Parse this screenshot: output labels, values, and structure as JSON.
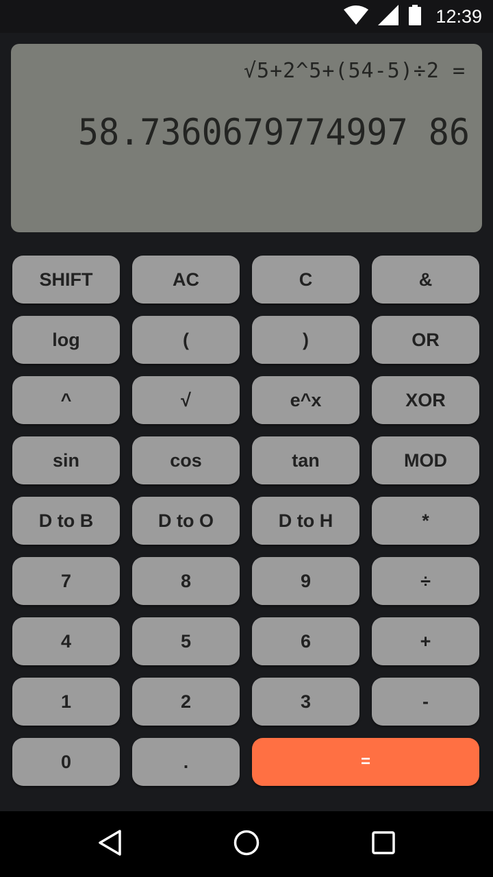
{
  "status_bar": {
    "time": "12:39",
    "icons": [
      "wifi-icon",
      "signal-icon",
      "battery-icon"
    ]
  },
  "display": {
    "expression": "√5+2^5+(54-5)÷2 =",
    "result": "58.7360679774997 86"
  },
  "keys": [
    {
      "label": "SHIFT",
      "name": "shift-button"
    },
    {
      "label": "AC",
      "name": "all-clear-button"
    },
    {
      "label": "C",
      "name": "clear-button"
    },
    {
      "label": "&",
      "name": "and-button"
    },
    {
      "label": "log",
      "name": "log-button"
    },
    {
      "label": "(",
      "name": "open-paren-button"
    },
    {
      "label": ")",
      "name": "close-paren-button"
    },
    {
      "label": "OR",
      "name": "or-button"
    },
    {
      "label": "^",
      "name": "power-button"
    },
    {
      "label": "√",
      "name": "sqrt-button"
    },
    {
      "label": "e^x",
      "name": "exp-button"
    },
    {
      "label": "XOR",
      "name": "xor-button"
    },
    {
      "label": "sin",
      "name": "sin-button"
    },
    {
      "label": "cos",
      "name": "cos-button"
    },
    {
      "label": "tan",
      "name": "tan-button"
    },
    {
      "label": "MOD",
      "name": "mod-button"
    },
    {
      "label": "D to B",
      "name": "dec-to-bin-button"
    },
    {
      "label": "D to O",
      "name": "dec-to-oct-button"
    },
    {
      "label": "D to H",
      "name": "dec-to-hex-button"
    },
    {
      "label": "*",
      "name": "multiply-button"
    },
    {
      "label": "7",
      "name": "digit-7-button"
    },
    {
      "label": "8",
      "name": "digit-8-button"
    },
    {
      "label": "9",
      "name": "digit-9-button"
    },
    {
      "label": "÷",
      "name": "divide-button"
    },
    {
      "label": "4",
      "name": "digit-4-button"
    },
    {
      "label": "5",
      "name": "digit-5-button"
    },
    {
      "label": "6",
      "name": "digit-6-button"
    },
    {
      "label": "+",
      "name": "add-button"
    },
    {
      "label": "1",
      "name": "digit-1-button"
    },
    {
      "label": "2",
      "name": "digit-2-button"
    },
    {
      "label": "3",
      "name": "digit-3-button"
    },
    {
      "label": "-",
      "name": "subtract-button"
    },
    {
      "label": "0",
      "name": "digit-0-button"
    },
    {
      "label": ".",
      "name": "decimal-point-button"
    },
    {
      "label": "=",
      "name": "equals-button",
      "accent": true
    }
  ],
  "colors": {
    "background": "#191a1d",
    "display": "#7b7d77",
    "key": "#9c9c9c",
    "accent": "#ff7043"
  },
  "nav_bar": {
    "icons": [
      "back-icon",
      "home-icon",
      "recents-icon"
    ]
  }
}
